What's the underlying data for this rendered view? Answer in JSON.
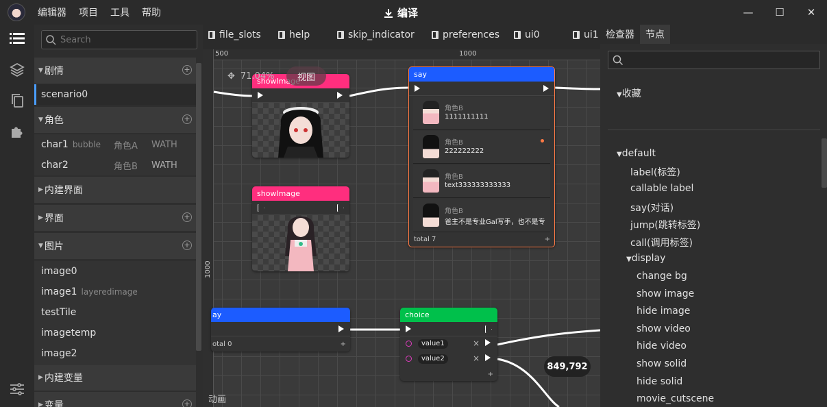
{
  "titlebar": {
    "menu": [
      "编辑器",
      "项目",
      "工具",
      "帮助"
    ],
    "title": "编译",
    "controls": [
      "—",
      "☐",
      "✕"
    ]
  },
  "sidebar": {
    "search_placeholder": "Search",
    "sections": {
      "story": "剧情",
      "roles": "角色",
      "builtin_ui": "内建界面",
      "ui": "界面",
      "images": "图片",
      "builtin_vars": "内建变量",
      "vars": "变量"
    },
    "story_items": [
      "scenario0"
    ],
    "roles": [
      {
        "name": "char1",
        "sub": "bubble",
        "label": "角色A",
        "extra": "WATH"
      },
      {
        "name": "char2",
        "sub": "",
        "label": "角色B",
        "extra": "WATH"
      }
    ],
    "images": [
      {
        "name": "image0",
        "sub": ""
      },
      {
        "name": "image1",
        "sub": "layeredimage"
      },
      {
        "name": "testTile",
        "sub": ""
      },
      {
        "name": "imagetemp",
        "sub": ""
      },
      {
        "name": "image2",
        "sub": ""
      }
    ]
  },
  "tabs": [
    "file_slots",
    "help",
    "skip_indicator",
    "preferences",
    "ui0",
    "ui1"
  ],
  "canvas": {
    "ruler_top": [
      "500",
      "1000"
    ],
    "ruler_left": [
      "1000"
    ],
    "zoom": "71.04%",
    "view_button": "视图",
    "coords": "849,792",
    "anim_label": "动画",
    "nodes": {
      "show1": {
        "title": "showImage",
        "color": "#ff2e7e"
      },
      "show2": {
        "title": "showImage",
        "color": "#ff2e7e"
      },
      "say": {
        "title": "say",
        "color": "#1c5cff",
        "rows": [
          {
            "who": "角色B",
            "text": "1111111111"
          },
          {
            "who": "角色B",
            "text": "222222222"
          },
          {
            "who": "角色B",
            "text": "text333333333333"
          },
          {
            "who": "角色B",
            "text": "爸主不是专业Gal写手，也不是专"
          }
        ],
        "footer": "total 7"
      },
      "say2": {
        "title": "ay",
        "color": "#1c5cff",
        "footer": "otal 0"
      },
      "choice": {
        "title": "choice",
        "color": "#00c04b",
        "options": [
          "value1",
          "value2"
        ]
      }
    }
  },
  "right_panel": {
    "tabs": [
      "检查器",
      "节点"
    ],
    "favorites": "收藏",
    "default_group": "default",
    "default_items": [
      "label(标签)",
      "callable label",
      "say(对话)",
      "jump(跳转标签)",
      "call(调用标签)"
    ],
    "display_group": "display",
    "display_items": [
      "change bg",
      "show image",
      "hide image",
      "show video",
      "hide video",
      "show solid",
      "hide solid",
      "movie_cutscene"
    ]
  }
}
